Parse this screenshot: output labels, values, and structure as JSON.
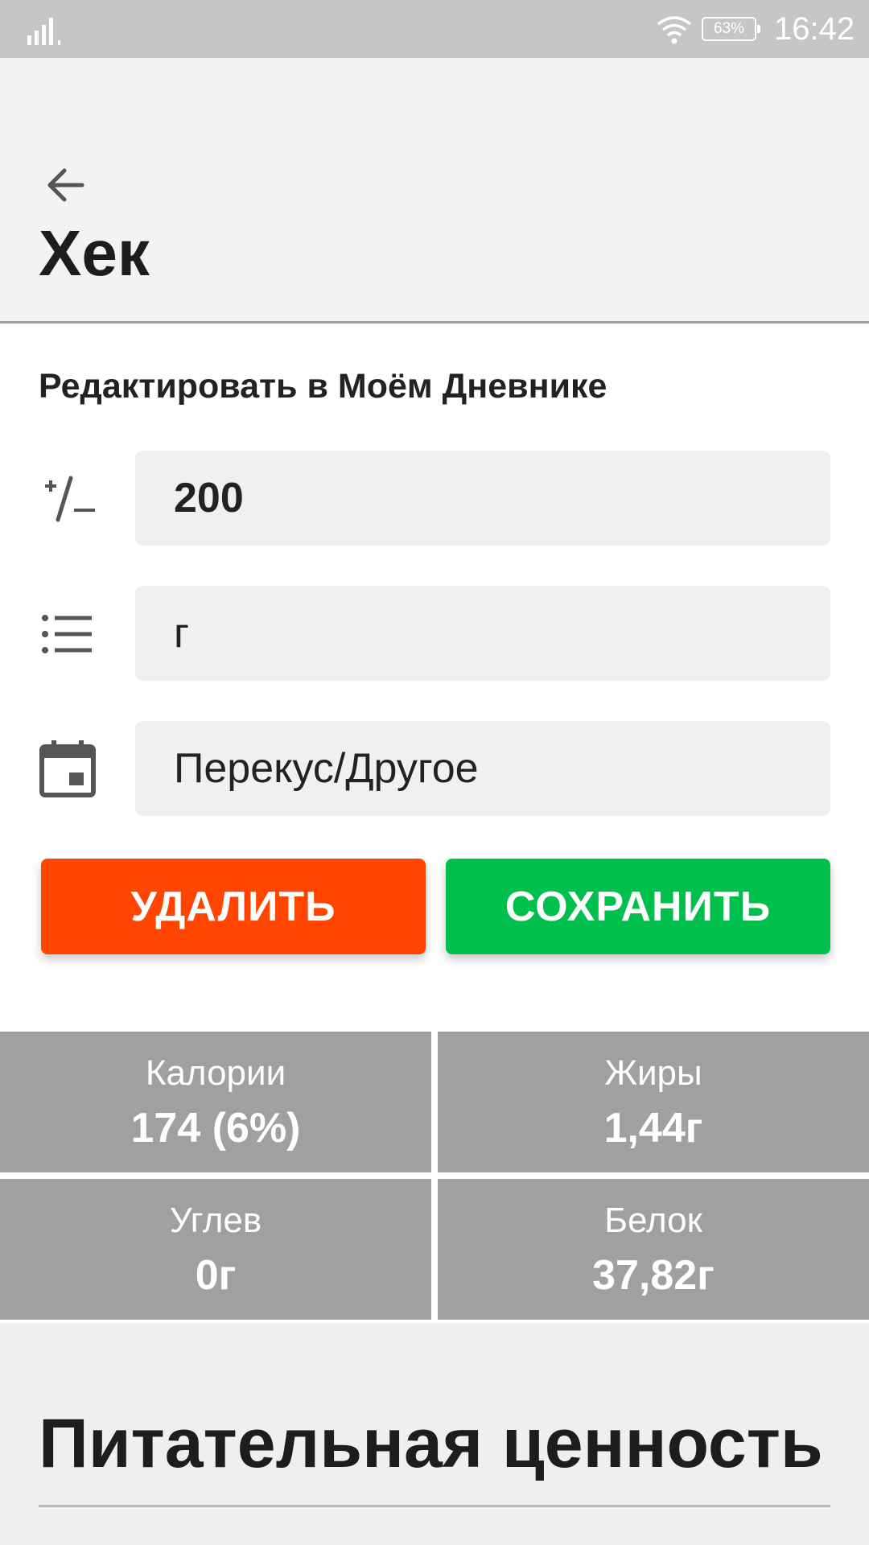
{
  "status_bar": {
    "battery": "63%",
    "time": "16:42",
    "icons": [
      "signal-icon",
      "wifi-icon",
      "battery-icon"
    ]
  },
  "header": {
    "back_icon": "arrow-left-icon",
    "title": "Хек"
  },
  "edit": {
    "section_title": "Редактировать в Моём Дневнике",
    "quantity": {
      "icon": "plus-minus-icon",
      "value": "200"
    },
    "unit": {
      "icon": "list-icon",
      "value": "г"
    },
    "meal": {
      "icon": "calendar-icon",
      "value": "Перекус/Другое"
    },
    "delete_label": "УДАЛИТЬ",
    "save_label": "СОХРАНИТЬ"
  },
  "colors": {
    "delete": "#ff4500",
    "save": "#00bf4c",
    "macro_bg": "#a0a0a0"
  },
  "macros": [
    {
      "label": "Калории",
      "value": "174 (6%)"
    },
    {
      "label": "Жиры",
      "value": "1,44г"
    },
    {
      "label": "Углев",
      "value": "0г"
    },
    {
      "label": "Белок",
      "value": "37,82г"
    }
  ],
  "nutrition": {
    "heading": "Питательная ценность"
  }
}
